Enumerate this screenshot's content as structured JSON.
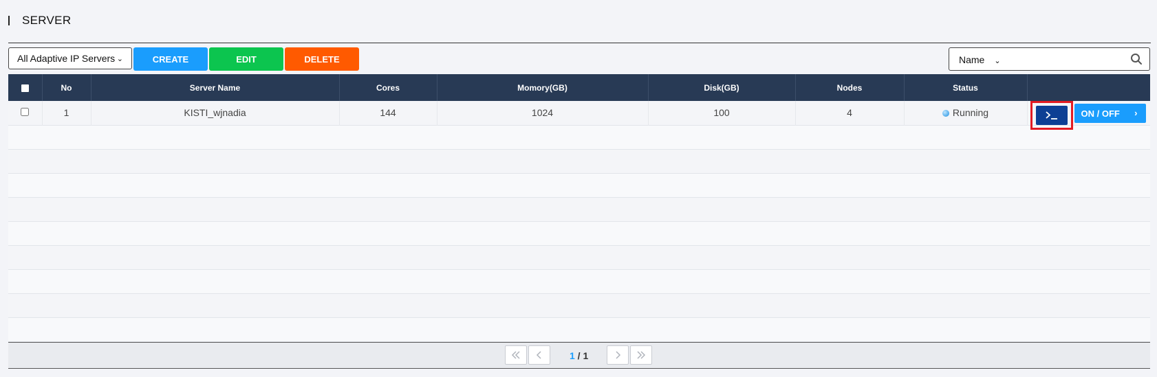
{
  "header": {
    "title": "SERVER"
  },
  "toolbar": {
    "filter_value": "All Adaptive IP Servers",
    "create_label": "CREATE",
    "edit_label": "EDIT",
    "delete_label": "DELETE",
    "search_field": "Name",
    "search_value": "",
    "search_placeholder": ""
  },
  "table": {
    "columns": [
      "No",
      "Server Name",
      "Cores",
      "Momory(GB)",
      "Disk(GB)",
      "Nodes",
      "Status"
    ],
    "rows": [
      {
        "no": "1",
        "server_name": "KISTI_wjnadia",
        "cores": "144",
        "memory": "1024",
        "disk": "100",
        "nodes": "4",
        "status": "Running"
      }
    ],
    "actions": {
      "onoff_label": "ON / OFF"
    }
  },
  "pagination": {
    "current": "1",
    "separator": " / ",
    "total": "1"
  },
  "colors": {
    "header_bg": "#283a55",
    "create": "#1a9dfd",
    "edit": "#0cc54f",
    "delete": "#ff5a00",
    "terminal": "#0d3f94",
    "highlight": "#e31b23"
  },
  "icons": {
    "search": "search-icon",
    "terminal": "terminal-icon",
    "first_page": "double-chevron-left-icon",
    "prev_page": "chevron-left-icon",
    "next_page": "chevron-right-icon",
    "last_page": "double-chevron-right-icon"
  }
}
